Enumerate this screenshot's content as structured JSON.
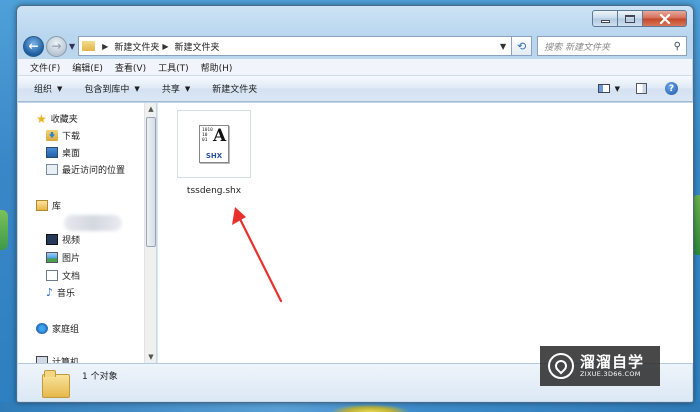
{
  "window": {
    "nav": {
      "back_icon": "back-arrow-icon",
      "forward_icon": "forward-arrow-icon"
    },
    "address": {
      "breadcrumbs": [
        "新建文件夹",
        "新建文件夹"
      ],
      "search_placeholder": "搜索 新建文件夹"
    },
    "menubar": [
      "文件(F)",
      "编辑(E)",
      "查看(V)",
      "工具(T)",
      "帮助(H)"
    ],
    "commandbar": {
      "organize": "组织",
      "include_in_library": "包含到库中",
      "share": "共享",
      "new_folder": "新建文件夹"
    },
    "sidebar": {
      "favorites": "收藏夹",
      "downloads": "下载",
      "desktop": "桌面",
      "recent": "最近访问的位置",
      "libraries": "库",
      "videos": "视频",
      "pictures": "图片",
      "documents": "文档",
      "music": "音乐",
      "homegroup": "家庭组",
      "computer": "计算机"
    },
    "files": [
      {
        "name": "tssdeng.shx",
        "icon_label": "SHX",
        "icon_letter": "A",
        "icon_bits": "1010\n10\n01"
      }
    ],
    "details": {
      "status": "1 个对象"
    }
  },
  "watermark": {
    "title": "溜溜自学",
    "url": "ZIXUE.3D66.COM"
  },
  "colors": {
    "accent": "#1d5c9f",
    "arrow": "#e8312c",
    "title_bar": "#b9d6ef"
  }
}
